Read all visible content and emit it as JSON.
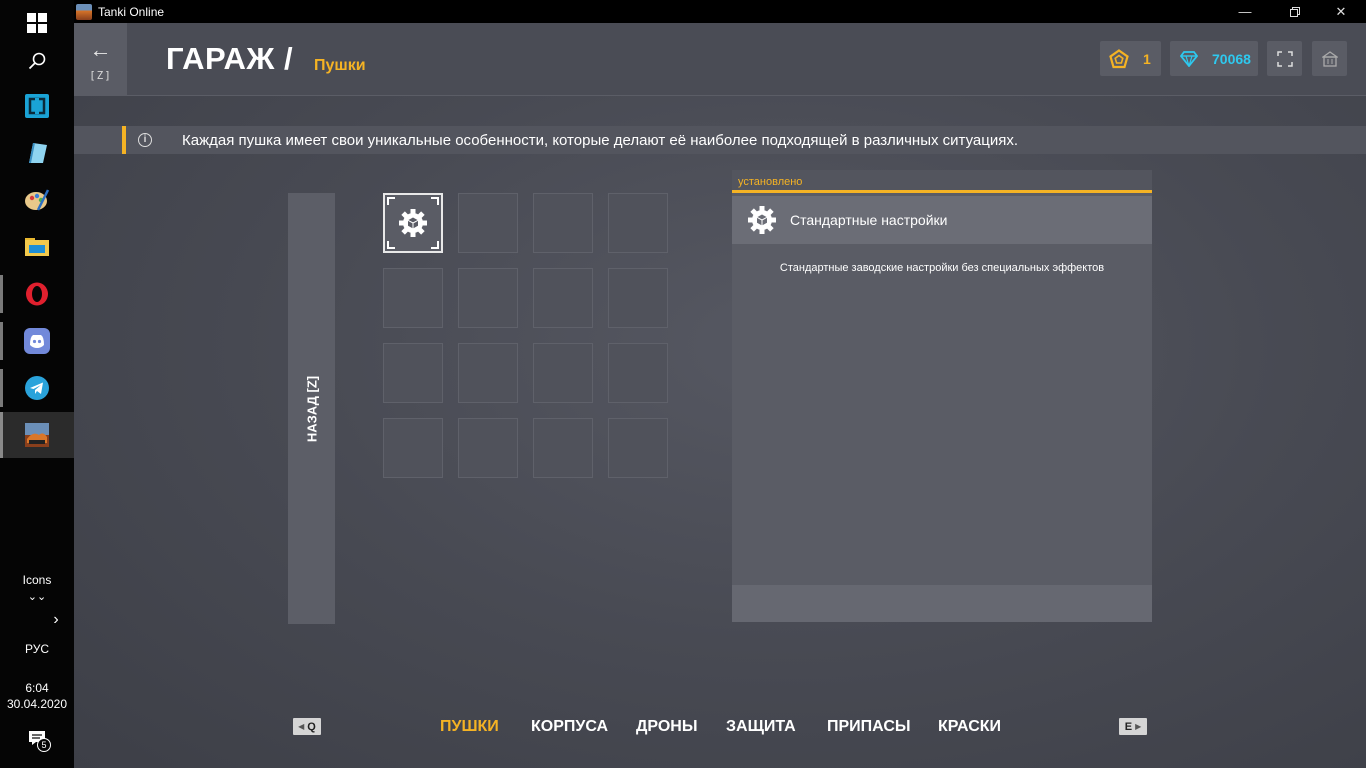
{
  "taskbar": {
    "items": [
      {
        "name": "windows-start-icon"
      },
      {
        "name": "search-icon"
      },
      {
        "name": "app-icon"
      },
      {
        "name": "notepad-icon"
      },
      {
        "name": "paint-icon"
      },
      {
        "name": "file-explorer-icon"
      },
      {
        "name": "opera-icon"
      },
      {
        "name": "discord-icon"
      },
      {
        "name": "telegram-icon"
      },
      {
        "name": "tanki-online-icon"
      }
    ],
    "icons_label": "Icons",
    "language": "РУС",
    "time": "6:04",
    "date": "30.04.2020",
    "notification_count": "5"
  },
  "window": {
    "title": "Tanki Online"
  },
  "header": {
    "back_key": "[Z]",
    "title": "ГАРАЖ /",
    "subtitle": "Пушки",
    "stars": "1",
    "crystals": "70068"
  },
  "info": {
    "text": "Каждая пушка имеет свои уникальные особенности, которые делают её наиболее подходящей в различных ситуациях."
  },
  "back_panel": {
    "label": "НАЗАД [Z]"
  },
  "details": {
    "status": "установлено",
    "item_name": "Стандартные настройки",
    "description": "Стандартные заводские настройки без специальных эффектов"
  },
  "nav": {
    "prev_key": "Q",
    "next_key": "E",
    "tabs": [
      {
        "label": "ПУШКИ",
        "active": true
      },
      {
        "label": "КОРПУСА",
        "active": false
      },
      {
        "label": "ДРОНЫ",
        "active": false
      },
      {
        "label": "ЗАЩИТА",
        "active": false
      },
      {
        "label": "ПРИПАСЫ",
        "active": false
      },
      {
        "label": "КРАСКИ",
        "active": false
      }
    ]
  },
  "colors": {
    "accent": "#f5b324",
    "crystal": "#2ec9ef"
  }
}
